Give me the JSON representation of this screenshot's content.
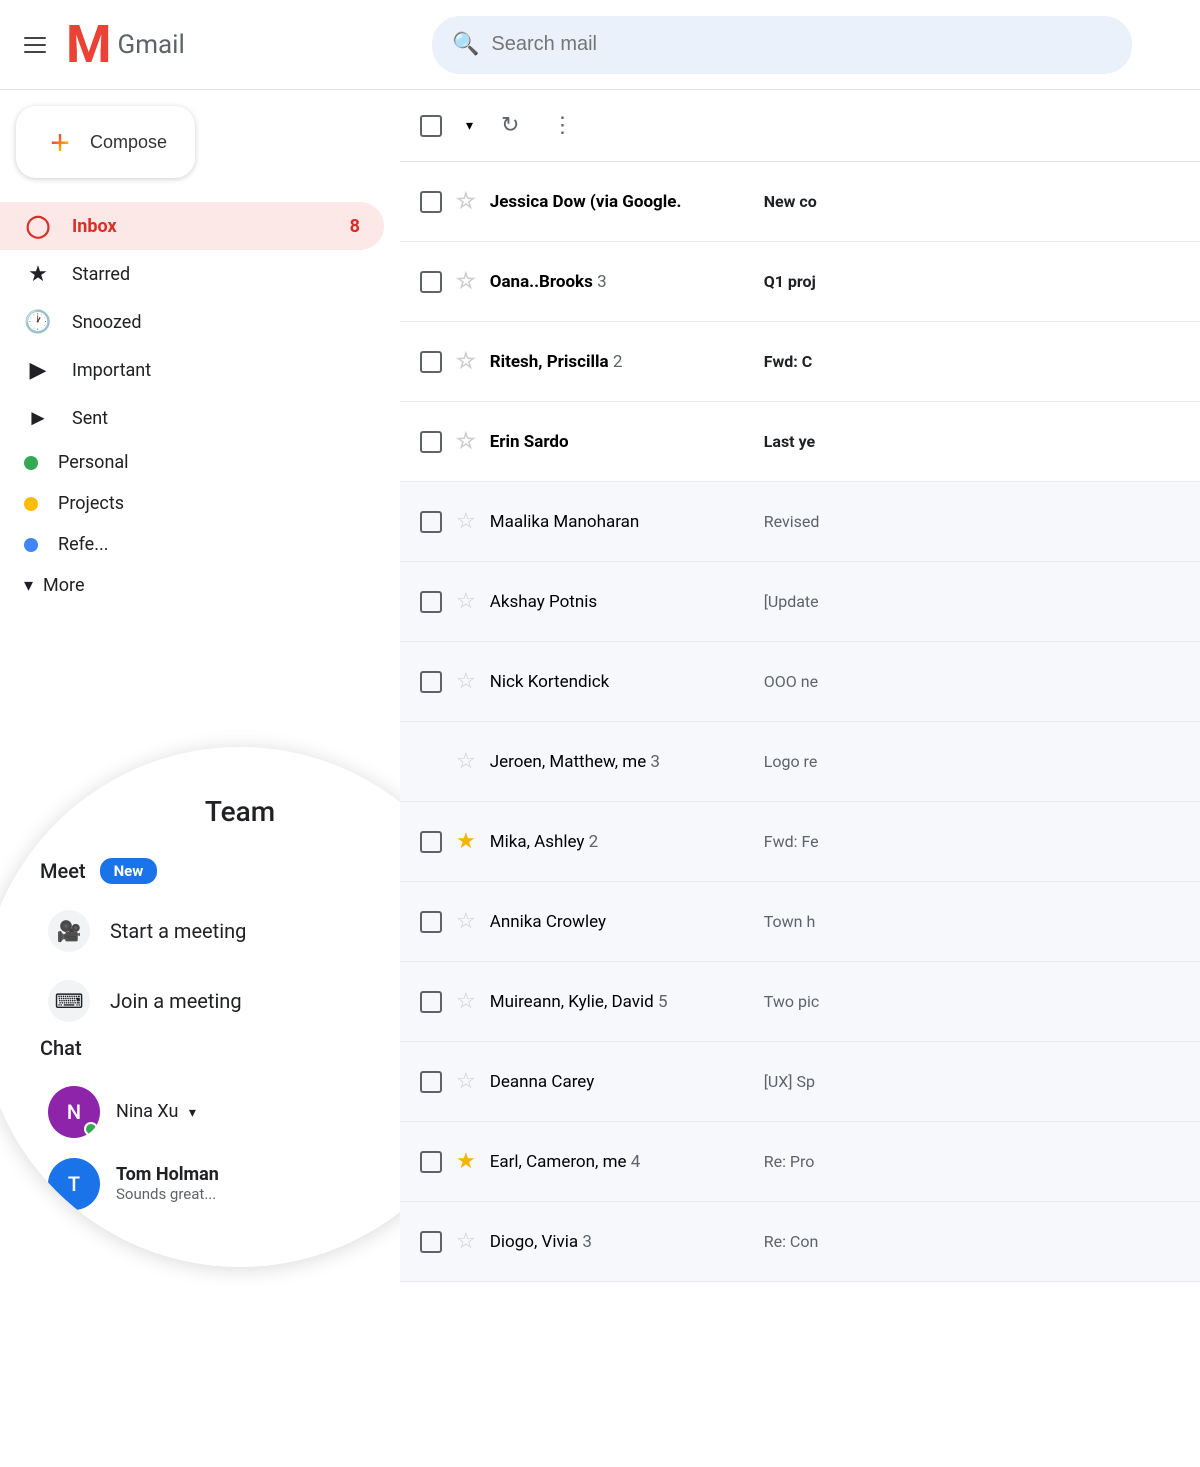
{
  "header": {
    "menu_icon": "☰",
    "gmail_label": "Gmail",
    "search_placeholder": "Search mail"
  },
  "compose": {
    "label": "Compose"
  },
  "sidebar": {
    "items": [
      {
        "id": "inbox",
        "label": "Inbox",
        "icon": "inbox",
        "badge": "8",
        "active": true
      },
      {
        "id": "starred",
        "label": "Starred",
        "icon": "star"
      },
      {
        "id": "snoozed",
        "label": "Snoozed",
        "icon": "clock"
      },
      {
        "id": "important",
        "label": "Important",
        "icon": "label"
      },
      {
        "id": "sent",
        "label": "Sent",
        "icon": "send"
      },
      {
        "id": "personal",
        "label": "Personal",
        "icon": "dot-green"
      },
      {
        "id": "projects",
        "label": "Projects",
        "icon": "dot-orange"
      },
      {
        "id": "references",
        "label": "References",
        "icon": "dot-blue"
      },
      {
        "id": "team",
        "label": "Team",
        "icon": "dot-red"
      }
    ],
    "more": {
      "label": "More",
      "chevron": "▾"
    }
  },
  "meet": {
    "label": "Meet",
    "badge": "New",
    "start_meeting": "Start a meeting",
    "join_meeting": "Join a meeting"
  },
  "chat": {
    "label": "Chat",
    "users": [
      {
        "name": "Nina Xu",
        "status": "online",
        "color": "#8E24AA"
      },
      {
        "name": "Tom Holman",
        "status": "offline",
        "color": "#1a73e8",
        "subtitle": "Sounds great..."
      }
    ]
  },
  "toolbar": {
    "select_all_label": "Select all",
    "refresh_label": "Refresh",
    "more_label": "More options"
  },
  "emails": [
    {
      "id": 1,
      "sender": "Jessica Dow (via Google.",
      "preview": "New co",
      "unread": true,
      "starred": false,
      "count": null
    },
    {
      "id": 2,
      "sender": "Oana..Brooks",
      "preview": "Q1 proj",
      "unread": true,
      "starred": false,
      "count": "3"
    },
    {
      "id": 3,
      "sender": "Ritesh, Priscilla",
      "preview": "Fwd: C",
      "unread": true,
      "starred": false,
      "count": "2"
    },
    {
      "id": 4,
      "sender": "Erin Sardo",
      "preview": "Last ye",
      "unread": true,
      "starred": false,
      "count": null
    },
    {
      "id": 5,
      "sender": "Maalika Manoharan",
      "preview": "Revised",
      "unread": false,
      "starred": false,
      "count": null
    },
    {
      "id": 6,
      "sender": "Akshay Potnis",
      "preview": "[Update",
      "unread": false,
      "starred": false,
      "count": null
    },
    {
      "id": 7,
      "sender": "Nick Kortendick",
      "preview": "OOO ne",
      "unread": false,
      "starred": false,
      "count": null
    },
    {
      "id": 8,
      "sender": "Jeroen, Matthew, me",
      "preview": "Logo re",
      "unread": false,
      "starred": false,
      "count": "3"
    },
    {
      "id": 9,
      "sender": "Mika, Ashley",
      "preview": "Fwd: Fe",
      "unread": false,
      "starred": true,
      "count": "2"
    },
    {
      "id": 10,
      "sender": "Annika Crowley",
      "preview": "Town h",
      "unread": false,
      "starred": false,
      "count": null
    },
    {
      "id": 11,
      "sender": "Muireann, Kylie, David",
      "preview": "Two pic",
      "unread": false,
      "starred": false,
      "count": "5"
    },
    {
      "id": 12,
      "sender": "Deanna Carey",
      "preview": "[UX] Sp",
      "unread": false,
      "starred": false,
      "count": null
    },
    {
      "id": 13,
      "sender": "Earl, Cameron, me",
      "preview": "Re: Pro",
      "unread": false,
      "starred": true,
      "count": "4"
    },
    {
      "id": 14,
      "sender": "Diogo, Vivia",
      "preview": "Re: Con",
      "unread": false,
      "starred": false,
      "count": "3"
    }
  ]
}
